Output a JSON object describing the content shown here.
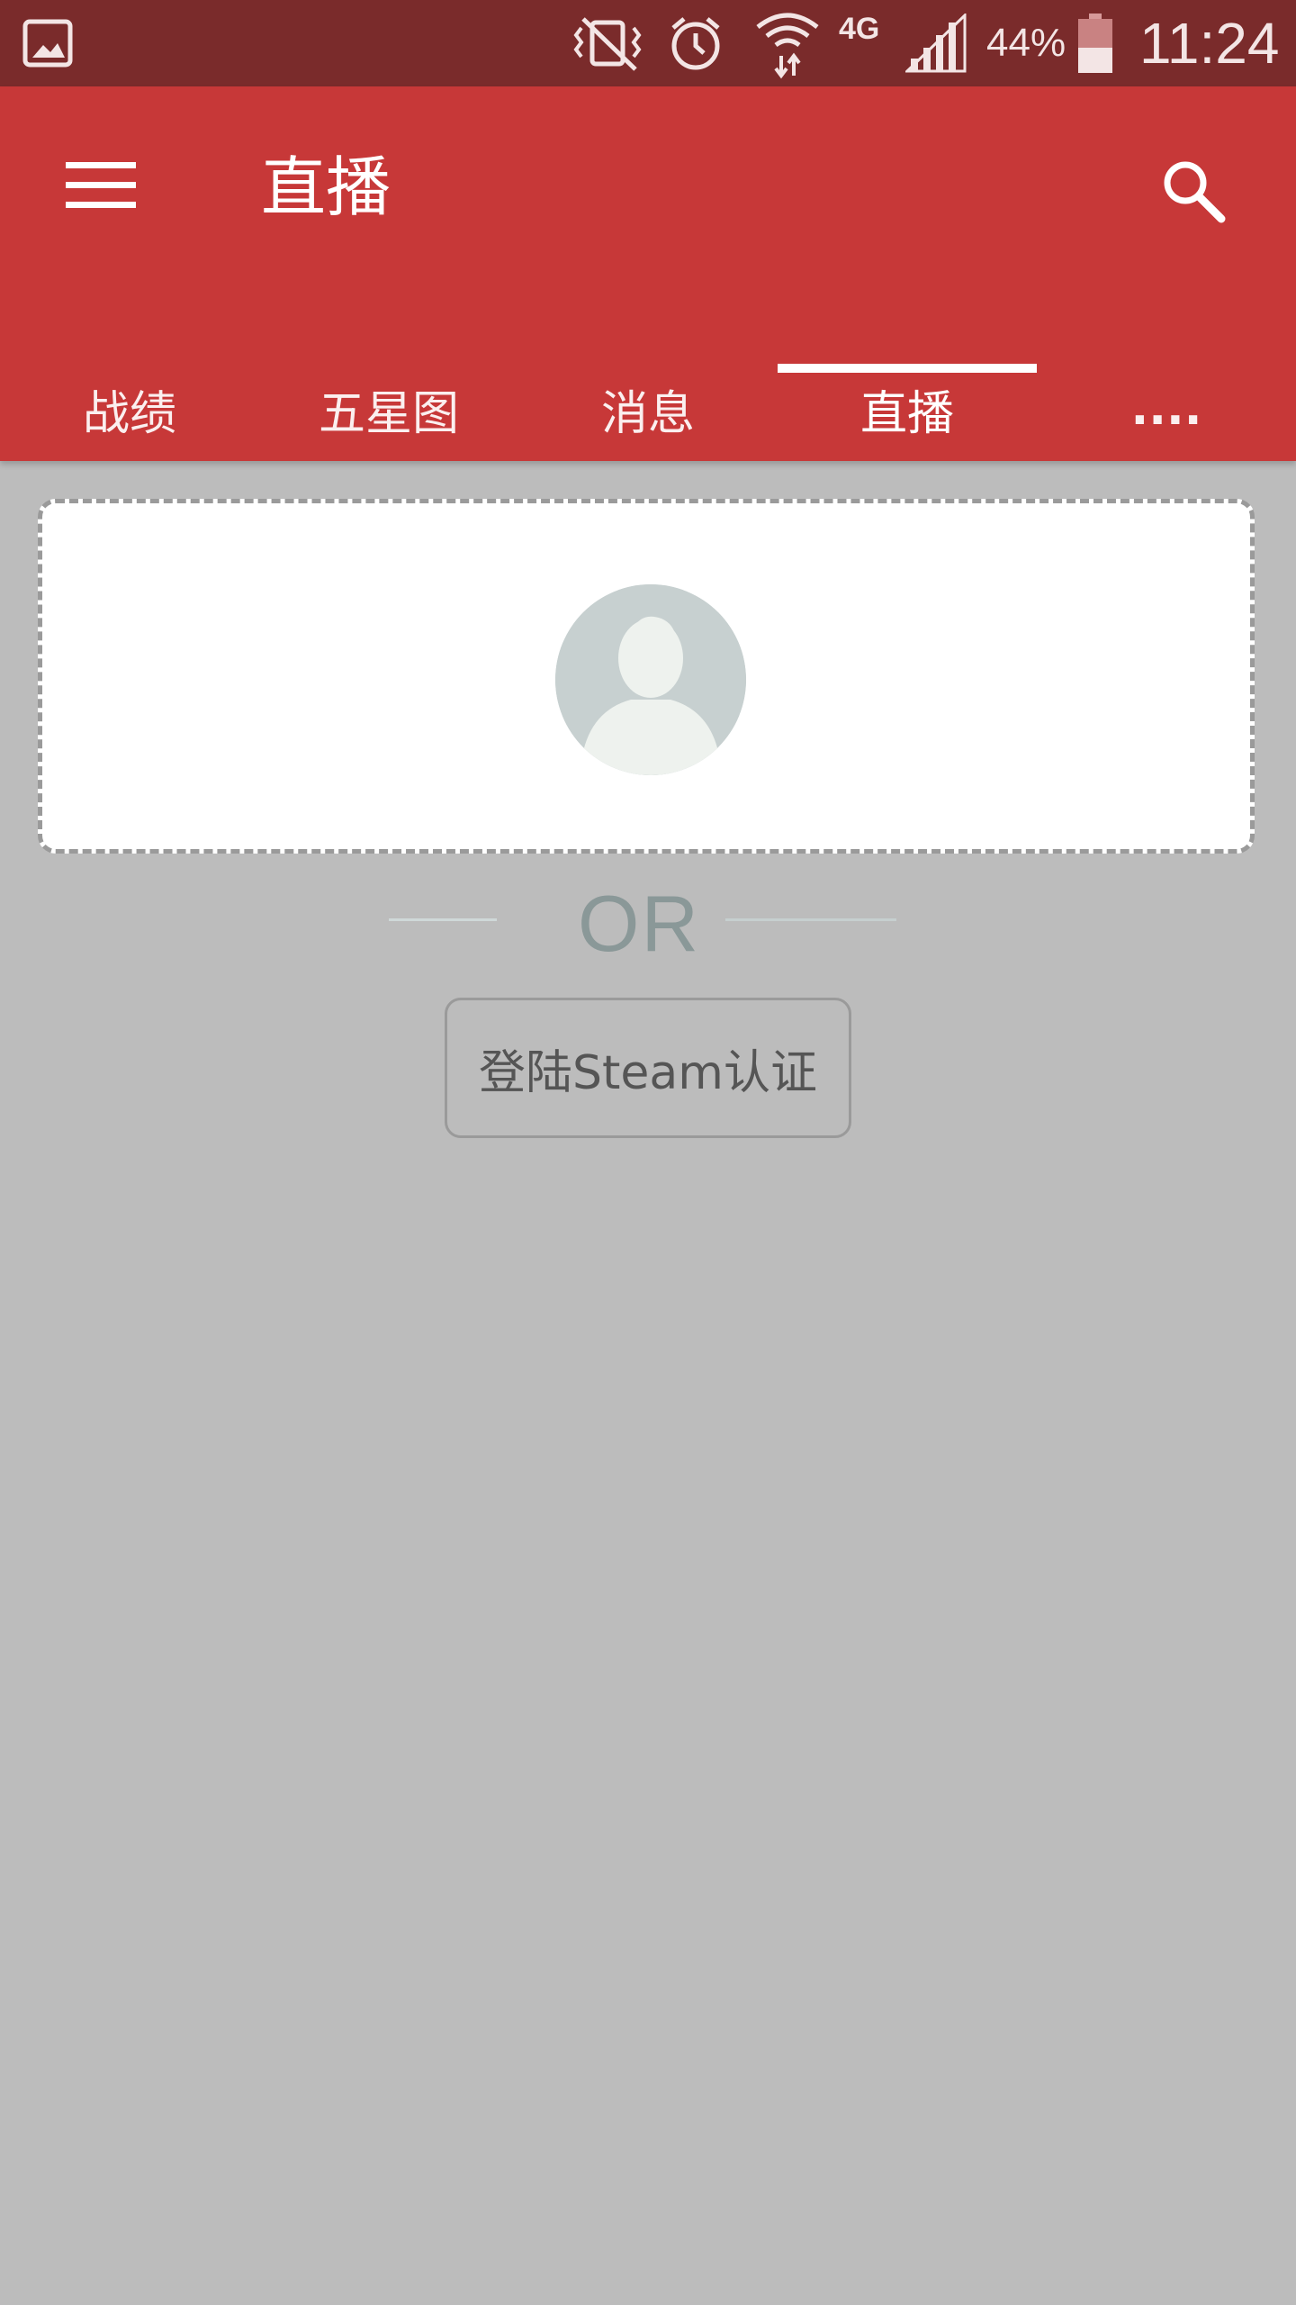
{
  "status_bar": {
    "battery_percent": "44%",
    "network_type": "4G",
    "time": "11:24",
    "icons": [
      "gallery-icon",
      "vibrate-off-icon",
      "alarm-icon",
      "wifi-icon",
      "signal-icon",
      "battery-icon"
    ]
  },
  "app_bar": {
    "title": "直播",
    "menu_icon": "hamburger-icon",
    "search_icon": "search-icon"
  },
  "tabs": [
    {
      "label": "战绩",
      "selected": false
    },
    {
      "label": "五星图",
      "selected": false
    },
    {
      "label": "消息",
      "selected": false
    },
    {
      "label": "直播",
      "selected": true
    },
    {
      "label": "....",
      "selected": false
    }
  ],
  "login": {
    "or_label": "OR",
    "steam_button_label": "登陆Steam认证",
    "avatar_icon": "default-user-avatar-icon"
  },
  "colors": {
    "primary": "#c73838",
    "status_bar": "#7a2b2b",
    "background": "#bcbcbc"
  }
}
